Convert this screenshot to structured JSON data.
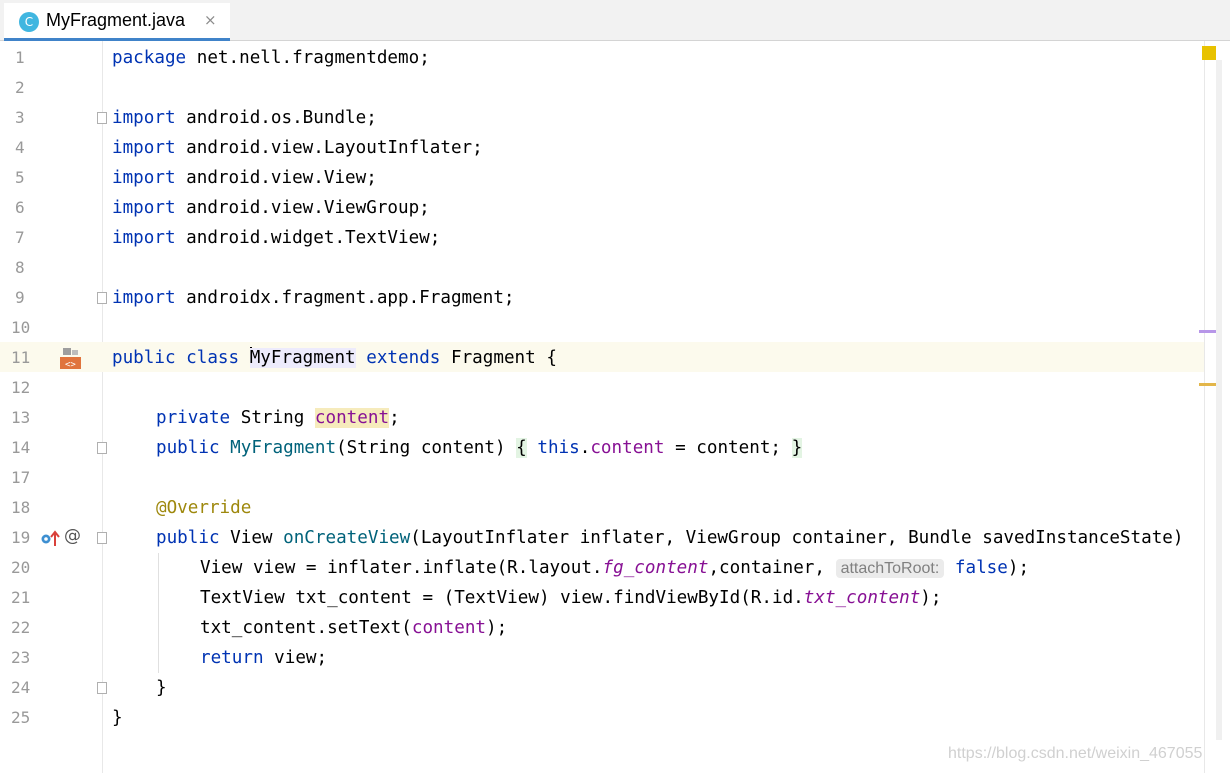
{
  "tab": {
    "icon_letter": "C",
    "title": "MyFragment.java",
    "close": "×"
  },
  "line_numbers": [
    "1",
    "2",
    "3",
    "4",
    "5",
    "6",
    "7",
    "8",
    "9",
    "10",
    "11",
    "12",
    "13",
    "14",
    "17",
    "18",
    "19",
    "20",
    "21",
    "22",
    "23",
    "24",
    "25"
  ],
  "code": {
    "l1_kw": "package",
    "l1_rest": " net.nell.fragmentdemo;",
    "imp": "import",
    "l3": " android.os.Bundle;",
    "l4": " android.view.LayoutInflater;",
    "l5": " android.view.View;",
    "l6": " android.view.ViewGroup;",
    "l7": " android.widget.TextView;",
    "l9": " androidx.fragment.app.Fragment;",
    "l11_kw": "public class ",
    "l11_cls": "MyFragment",
    "l11_kw2": " extends ",
    "l11_rest": "Fragment {",
    "l13_kw": "private ",
    "l13_type": "String ",
    "l13_fld": "content",
    "l13_end": ";",
    "l14_kw": "public ",
    "l14_mth": "MyFragment",
    "l14_a": "(String content) ",
    "l14_ob": "{",
    "l14_this": " this",
    "l14_dot": ".",
    "l14_fld": "content",
    "l14_b": " = content; ",
    "l14_cb": "}",
    "l18": "@Override",
    "l19_kw": "public ",
    "l19_a": "View ",
    "l19_mth": "onCreateView",
    "l19_b": "(LayoutInflater inflater, ViewGroup container, Bundle savedInstanceState)",
    "l20_a": "View view = inflater.inflate(R.layout.",
    "l20_it": "fg_content",
    "l20_b": ",container, ",
    "l20_hint": "attachToRoot:",
    "l20_kw": " false",
    "l20_c": ");",
    "l21_a": "TextView txt_content = (TextView) view.findViewById(R.id.",
    "l21_it": "txt_content",
    "l21_b": ");",
    "l22_a": "txt_content.setText(",
    "l22_fld": "content",
    "l22_b": ");",
    "l23_kw": "return",
    "l23_b": " view;",
    "l24": "}",
    "l25": "}"
  },
  "gutter_icons": {
    "line11": "fragment-layout-icon",
    "line19_a": "override-arrow-icon",
    "line19_b": "at-annotation-icon",
    "at_symbol": "@"
  },
  "colors": {
    "keyword": "#0033b3",
    "field": "#871094",
    "method": "#00627a",
    "annotation": "#9e880d",
    "accent": "#4083c9"
  },
  "watermark": "https://blog.csdn.net/weixin_467055"
}
